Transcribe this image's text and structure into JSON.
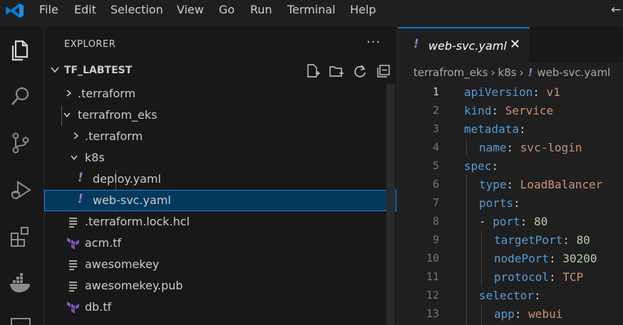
{
  "menu": [
    "File",
    "Edit",
    "Selection",
    "View",
    "Go",
    "Run",
    "Terminal",
    "Help"
  ],
  "explorer": {
    "title": "EXPLORER",
    "more": "···",
    "root": "TF_LABTEST",
    "items": [
      {
        "label": ".terraform"
      },
      {
        "label": "terrafrom_eks"
      },
      {
        "label": ".terraform"
      },
      {
        "label": "k8s"
      },
      {
        "label": "deploy.yaml"
      },
      {
        "label": "web-svc.yaml"
      },
      {
        "label": ".terraform.lock.hcl"
      },
      {
        "label": "acm.tf"
      },
      {
        "label": "awesomekey"
      },
      {
        "label": "awesomekey.pub"
      },
      {
        "label": "db.tf"
      }
    ]
  },
  "editor": {
    "tab": {
      "bang": "!",
      "label": "web-svc.yaml",
      "close": "✕"
    },
    "breadcrumb": [
      "terrafrom_eks",
      "k8s",
      "web-svc.yaml"
    ],
    "lines": [
      {
        "no": "1",
        "key": "apiVersion",
        "val": "v1"
      },
      {
        "no": "2",
        "key": "kind",
        "val": "Service"
      },
      {
        "no": "3",
        "key": "metadata",
        "val": ""
      },
      {
        "no": "4",
        "key": "name",
        "val": "svc-login"
      },
      {
        "no": "5",
        "key": "spec",
        "val": ""
      },
      {
        "no": "6",
        "key": "type",
        "val": "LoadBalancer"
      },
      {
        "no": "7",
        "key": "ports",
        "val": ""
      },
      {
        "no": "8",
        "key": "port",
        "val": "80"
      },
      {
        "no": "9",
        "key": "targetPort",
        "val": "80"
      },
      {
        "no": "10",
        "key": "nodePort",
        "val": "30200"
      },
      {
        "no": "11",
        "key": "protocol",
        "val": "TCP"
      },
      {
        "no": "12",
        "key": "selector",
        "val": ""
      },
      {
        "no": "13",
        "key": "app",
        "val": "webui"
      }
    ]
  },
  "colors": {
    "accent": "#0078d4",
    "selection": "#04395e",
    "yaml_bang": "#a074c4",
    "terraform": "#844fba"
  }
}
